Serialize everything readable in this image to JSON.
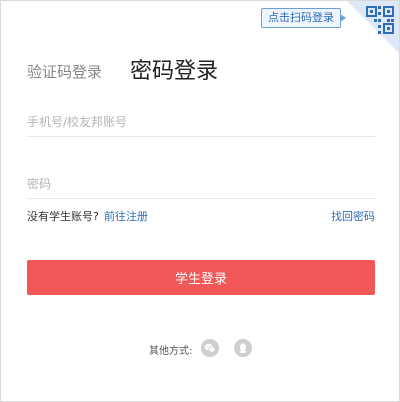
{
  "qr": {
    "tooltip": "点击扫码登录",
    "icon": "qr-code-icon",
    "corner_color": "#dde7f5",
    "accent": "#2f6db5"
  },
  "tabs": {
    "sms_label": "验证码登录",
    "password_label": "密码登录",
    "active": "password"
  },
  "form": {
    "account_placeholder": "手机号/校友邦账号",
    "account_value": "",
    "password_placeholder": "密码",
    "password_value": ""
  },
  "links": {
    "no_account": "没有学生账号?",
    "register": "前往注册",
    "forgot_password": "找回密码"
  },
  "login_button": {
    "label": "学生登录",
    "color": "#f25757"
  },
  "other_methods": {
    "label": "其他方式:",
    "icons": [
      "wechat-icon",
      "qq-icon"
    ]
  }
}
